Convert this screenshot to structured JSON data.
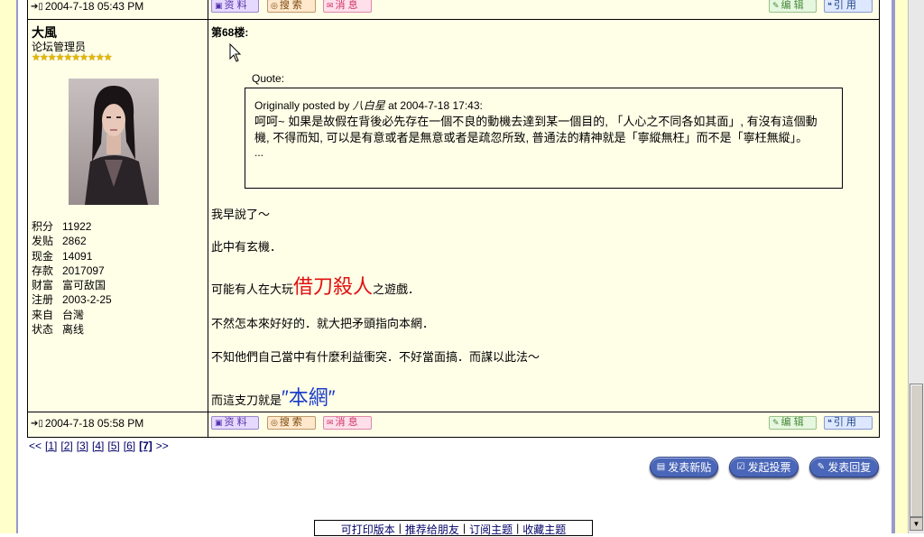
{
  "prev_post": {
    "time": "2004-7-18 05:43 PM",
    "buttons": {
      "profile": "资 料",
      "search": "搜 索",
      "message": "消 息",
      "edit": "编 辑",
      "quote": "引 用"
    }
  },
  "post": {
    "floor": "第68楼:",
    "user": {
      "name": "大風",
      "role": "论坛管理员",
      "stars": "★★★★★★★★★★",
      "stats": [
        {
          "label": "积分",
          "value": "11922"
        },
        {
          "label": "发贴",
          "value": "2862"
        },
        {
          "label": "现金",
          "value": "14091"
        },
        {
          "label": "存款",
          "value": "2017097"
        },
        {
          "label": "财富",
          "value": "富可敌国"
        },
        {
          "label": "注册",
          "value": "2003-2-25"
        },
        {
          "label": "来自",
          "value": "台灣"
        },
        {
          "label": "状态",
          "value": "离线"
        }
      ]
    },
    "quote": {
      "label": "Quote:",
      "origin_prefix": "Originally posted by",
      "origin_name": "八白星",
      "origin_suffix": "at 2004-7-18 17:43:",
      "body": "呵呵~ 如果是故假在背後必先存在一個不良的動機去達到某一個目的, 「人心之不同各如其面」, 有沒有這個動機, 不得而知, 可以是有意或者是無意或者是疏忽所致, 普通法的精神就是「寧縱無枉」而不是「寧枉無縱」。",
      "ellipsis": "..."
    },
    "message": {
      "line1": "我早說了～",
      "line2": "此中有玄機．",
      "line3_pre": "可能有人在大玩",
      "line3_big": "借刀殺人",
      "line3_post": "之遊戲．",
      "line4": "不然怎本來好好的．就大把矛頭指向本網．",
      "line5": "不知他們自己當中有什麼利益衝突．不好當面搞．而謀以此法～",
      "line6_pre": "而這支刀就是",
      "line6_big": "″本網″"
    },
    "time": "2004-7-18 05:58 PM",
    "buttons": {
      "profile": "资 料",
      "search": "搜 索",
      "message": "消 息",
      "edit": "编 辑",
      "quote": "引 用"
    }
  },
  "pagination": {
    "prev": "<<",
    "pages": [
      "[1]",
      "[2]",
      "[3]",
      "[4]",
      "[5]",
      "[6]"
    ],
    "current": "[7]",
    "next": ">>"
  },
  "actions": {
    "new_topic": "发表新贴",
    "new_poll": "发起投票",
    "reply": "发表回复"
  },
  "tools": {
    "print": "可打印版本",
    "recommend": "推荐给朋友",
    "subscribe": "订阅主题",
    "favorite": "收藏主题"
  },
  "colors": {
    "page_band": "#ffffcc",
    "frame": "#9999cc",
    "post_bg": "#ffffe8",
    "highlight_red": "#e01010",
    "highlight_blue": "#1a3cc8",
    "action_button": "#4a66b8"
  }
}
